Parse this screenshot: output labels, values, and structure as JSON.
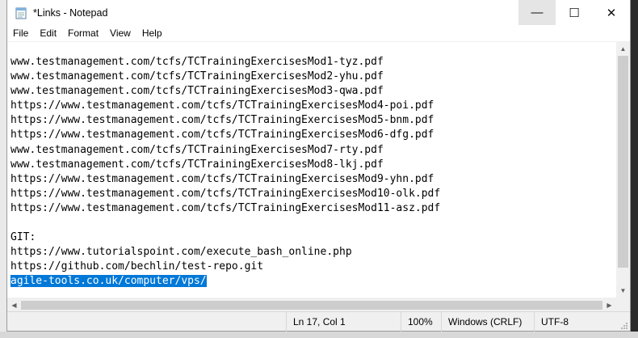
{
  "window": {
    "title": "*Links - Notepad",
    "controls": {
      "minimize": "—",
      "maximize": "☐",
      "close": "✕"
    }
  },
  "menu": {
    "items": [
      "File",
      "Edit",
      "Format",
      "View",
      "Help"
    ]
  },
  "editor": {
    "lines": [
      "www.testmanagement.com/tcfs/TCTrainingExercisesMod1-tyz.pdf",
      "www.testmanagement.com/tcfs/TCTrainingExercisesMod2-yhu.pdf",
      "www.testmanagement.com/tcfs/TCTrainingExercisesMod3-qwa.pdf",
      "https://www.testmanagement.com/tcfs/TCTrainingExercisesMod4-poi.pdf",
      "https://www.testmanagement.com/tcfs/TCTrainingExercisesMod5-bnm.pdf",
      "https://www.testmanagement.com/tcfs/TCTrainingExercisesMod6-dfg.pdf",
      "www.testmanagement.com/tcfs/TCTrainingExercisesMod7-rty.pdf",
      "www.testmanagement.com/tcfs/TCTrainingExercisesMod8-lkj.pdf",
      "https://www.testmanagement.com/tcfs/TCTrainingExercisesMod9-yhn.pdf",
      "https://www.testmanagement.com/tcfs/TCTrainingExercisesMod10-olk.pdf",
      "https://www.testmanagement.com/tcfs/TCTrainingExercisesMod11-asz.pdf",
      "",
      "GIT:",
      "https://www.tutorialspoint.com/execute_bash_online.php",
      "https://github.com/bechlin/test-repo.git",
      "agile-tools.co.uk/computer/vps/"
    ],
    "selected_line": 15
  },
  "status": {
    "position": "Ln 17, Col 1",
    "zoom": "100%",
    "line_ending": "Windows (CRLF)",
    "encoding": "UTF-8"
  },
  "colors": {
    "selection": "#0078d7",
    "status_bg": "#f0f0f0"
  }
}
